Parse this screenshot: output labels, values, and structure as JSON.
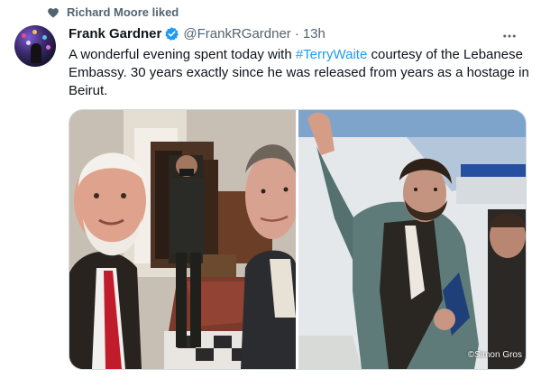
{
  "social_context": {
    "icon": "heart-icon",
    "text": "Richard Moore liked"
  },
  "author": {
    "display_name": "Frank Gardner",
    "verified": true,
    "handle": "@FrankRGardner",
    "separator": "·",
    "time": "13h"
  },
  "more_menu": {
    "icon": "more-horizontal-icon",
    "label": "···"
  },
  "tweet": {
    "text_before": "A wonderful evening spent today with ",
    "hashtag": "#TerryWaite",
    "text_after": " courtesy of the Lebanese Embassy. 30 years exactly since he was released from years as a hostage in Beirut."
  },
  "media": {
    "left_photo": "selfie-photo",
    "right_photo": "archive-photo",
    "credit": "©Simon Gros"
  },
  "colors": {
    "link": "#1d9bf0",
    "secondary_text": "#536471",
    "verified_badge": "#1d9bf0",
    "border": "#cfd9de"
  }
}
